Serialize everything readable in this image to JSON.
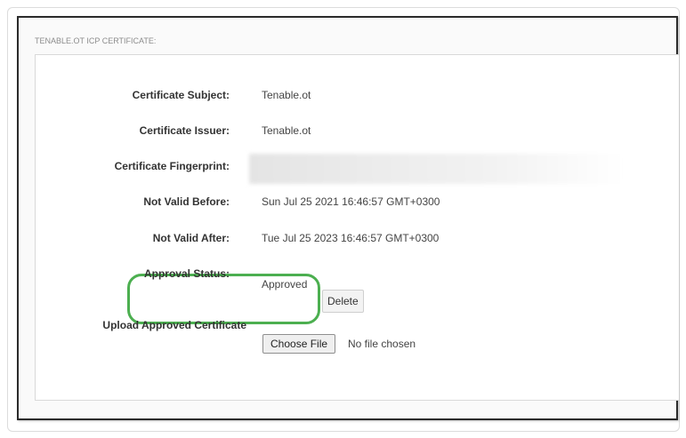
{
  "section_title": "TENABLE.OT ICP CERTIFICATE:",
  "fields": [
    {
      "label": "Certificate Subject:",
      "value": "Tenable.ot"
    },
    {
      "label": "Certificate Issuer:",
      "value": "Tenable.ot"
    },
    {
      "label": "Certificate Fingerprint:",
      "value": ""
    },
    {
      "label": "Not Valid Before:",
      "value": "Sun Jul 25 2021 16:46:57 GMT+0300"
    },
    {
      "label": "Not Valid After:",
      "value": "Tue Jul 25 2023 16:46:57 GMT+0300"
    }
  ],
  "approval": {
    "label": "Approval Status:",
    "value": "Approved",
    "delete_label": "Delete",
    "highlight_color": "#4caf50"
  },
  "upload": {
    "label": "Upload Approved Certificate",
    "button_label": "Choose File",
    "status_text": "No file chosen"
  }
}
